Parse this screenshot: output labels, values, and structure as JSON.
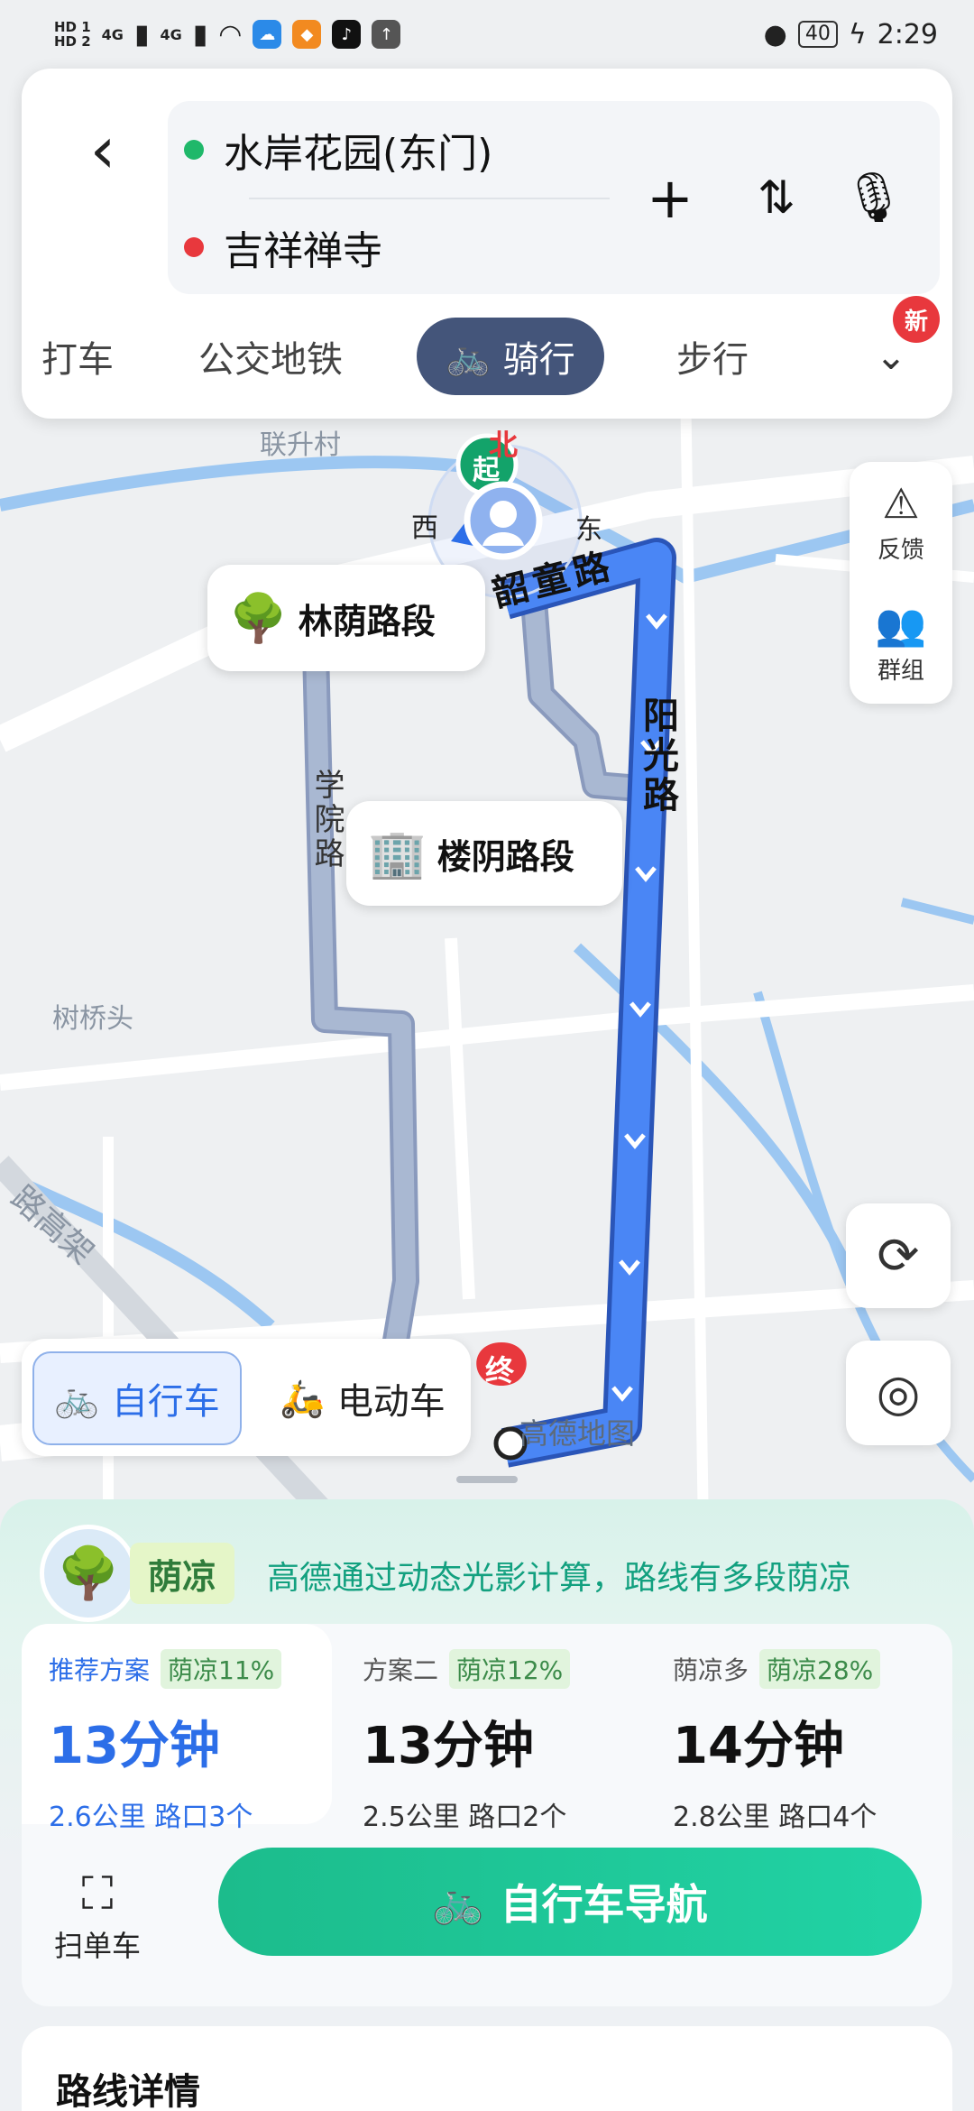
{
  "status_bar": {
    "hd1": "HD 1",
    "hd2": "HD 2",
    "net1": "4G",
    "net2": "4G",
    "battery": "40",
    "time": "2:29"
  },
  "route": {
    "start": "水岸花园(东门)",
    "end": "吉祥禅寺",
    "start_color": "#1fb86a",
    "end_color": "#e8383d"
  },
  "modes": {
    "taxi": "打车",
    "transit": "公交地铁",
    "ride": "骑行",
    "walk": "步行",
    "new_badge": "新"
  },
  "map": {
    "compass_north": "北",
    "compass_west": "西",
    "compass_east": "东",
    "start_marker": "起",
    "end_marker": "终",
    "place_lianshengcun": "联升村",
    "place_shuqiaotou": "树桥头",
    "road_shaotong": "韶童路",
    "road_yangguang": "阳光路",
    "road_xueyuan": "学院路",
    "road_gaojia": "路高架",
    "bubble_shade1": "林荫路段",
    "bubble_shade2": "楼阴路段",
    "watermark": "高德地图",
    "route_color": "#4a86f5",
    "alt_route_color": "#a9b8d2"
  },
  "side_panel": {
    "feedback": "反馈",
    "group": "群组"
  },
  "vehicle": {
    "bicycle": "自行车",
    "ebike": "电动车"
  },
  "shade": {
    "tag": "荫凉",
    "desc": "高德通过动态光影计算，路线有多段荫凉"
  },
  "plans": [
    {
      "name": "推荐方案",
      "pct": "荫凉11%",
      "time": "13分钟",
      "meta": "2.6公里  路口3个"
    },
    {
      "name": "方案二",
      "pct": "荫凉12%",
      "time": "13分钟",
      "meta": "2.5公里  路口2个"
    },
    {
      "name": "荫凉多",
      "pct": "荫凉28%",
      "time": "14分钟",
      "meta": "2.8公里  路口4个"
    }
  ],
  "actions": {
    "scan": "扫单车",
    "navigate": "自行车导航"
  },
  "details": {
    "title": "路线详情"
  }
}
